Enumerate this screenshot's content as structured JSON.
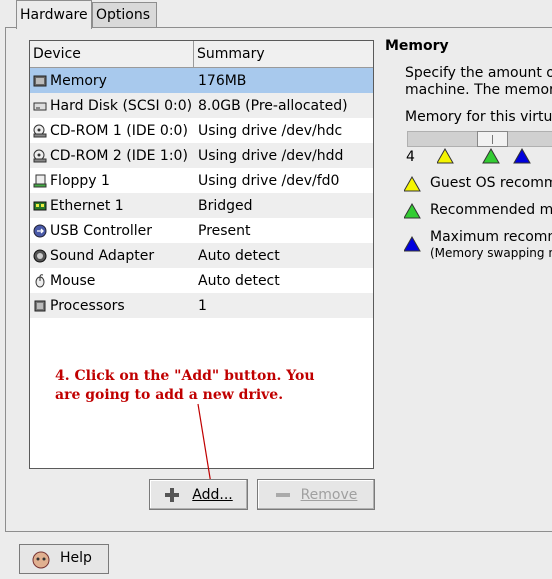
{
  "tabs": [
    {
      "label": "Hardware"
    },
    {
      "label": "Options"
    }
  ],
  "table": {
    "headers": {
      "device": "Device",
      "summary": "Summary"
    },
    "rows": [
      {
        "device": "Memory",
        "summary": "176MB",
        "icon": "memory-chip-icon"
      },
      {
        "device": "Hard Disk (SCSI 0:0)",
        "summary": "8.0GB (Pre-allocated)",
        "icon": "hard-disk-icon"
      },
      {
        "device": "CD-ROM 1 (IDE 0:0)",
        "summary": "Using drive /dev/hdc",
        "icon": "cdrom-icon"
      },
      {
        "device": "CD-ROM 2 (IDE 1:0)",
        "summary": "Using drive /dev/hdd",
        "icon": "cdrom-icon"
      },
      {
        "device": "Floppy 1",
        "summary": "Using drive /dev/fd0",
        "icon": "floppy-icon"
      },
      {
        "device": "Ethernet 1",
        "summary": "Bridged",
        "icon": "network-card-icon"
      },
      {
        "device": "USB Controller",
        "summary": "Present",
        "icon": "usb-icon"
      },
      {
        "device": "Sound Adapter",
        "summary": "Auto detect",
        "icon": "sound-icon"
      },
      {
        "device": "Mouse",
        "summary": "Auto detect",
        "icon": "mouse-icon"
      },
      {
        "device": "Processors",
        "summary": "1",
        "icon": "processor-icon"
      }
    ]
  },
  "annotation": {
    "line1": "4. Click on the \"Add\" button.  You",
    "line2": "are going to add a new drive."
  },
  "buttons": {
    "add": "Add...",
    "remove": "Remove",
    "help": "Help"
  },
  "memory_panel": {
    "title": "Memory",
    "desc_line1": "Specify the amount of",
    "desc_line2": "machine. The memor",
    "for_vm_label": "Memory for this virtua",
    "slider_min": "4",
    "slider_level_fraction": 0.45,
    "legend": [
      {
        "text": "Guest OS recomm",
        "color": "#f5f500"
      },
      {
        "text": "Recommended m",
        "color": "#33cc33"
      },
      {
        "text": "Maximum recomm",
        "subtext": "(Memory swapping n",
        "color": "#0000dd"
      }
    ]
  },
  "colors": {
    "selection": "#a8c9ed",
    "annotation": "#c00000"
  }
}
